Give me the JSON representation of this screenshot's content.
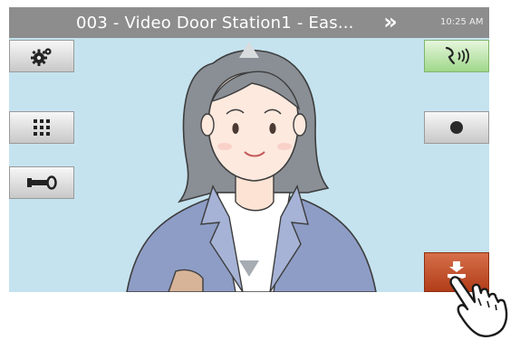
{
  "title_bar": {
    "station_title": "003 - Video Door Station1 - Eas...",
    "more_glyph": "»",
    "time": "10:25 AM"
  },
  "left_buttons": [
    {
      "name": "settings-button",
      "icon": "gear-icon"
    },
    {
      "name": "keypad-button",
      "icon": "keypad-icon"
    },
    {
      "name": "door-release-button",
      "icon": "key-icon"
    }
  ],
  "right_buttons": [
    {
      "name": "talk-button",
      "icon": "talk-icon",
      "color": "#a8dc92"
    },
    {
      "name": "record-button",
      "icon": "record-icon"
    },
    {
      "name": "hang-up-button",
      "icon": "hang-up-icon",
      "color": "#c1471f"
    }
  ],
  "camera_view": {
    "background_color": "#c5e3ef",
    "pan_up_icon": "arrow-up-icon",
    "pan_down_icon": "arrow-down-icon"
  },
  "colors": {
    "title_bar": "#8d8d8d",
    "accent_green": "#a8dc92",
    "accent_red": "#c1471f"
  }
}
